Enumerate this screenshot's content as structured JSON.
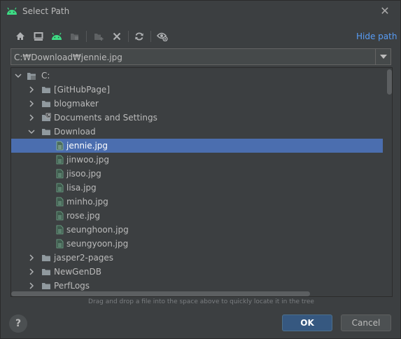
{
  "window": {
    "title": "Select Path"
  },
  "toolbar": {
    "buttons": [
      "home-icon",
      "desktop-icon",
      "android-project-icon",
      "module-icon",
      "new-folder-icon",
      "delete-icon",
      "refresh-icon",
      "show-hidden-icon"
    ],
    "hide_path_label": "Hide path"
  },
  "path": {
    "value": "C:₩Download₩jennie.jpg"
  },
  "tree": {
    "root": "C:",
    "folders_top": [
      "[GitHubPage]",
      "blogmaker",
      "Documents and Settings",
      "Download"
    ],
    "download_files": [
      "jennie.jpg",
      "jinwoo.jpg",
      "jisoo.jpg",
      "lisa.jpg",
      "minho.jpg",
      "rose.jpg",
      "seunghoon.jpg",
      "seungyoon.jpg"
    ],
    "selected": "jennie.jpg",
    "folders_bottom": [
      "jasper2-pages",
      "NewGenDB",
      "PerfLogs"
    ]
  },
  "hint": "Drag and drop a file into the space above to quickly locate it in the tree",
  "buttons": {
    "help": "?",
    "ok": "OK",
    "cancel": "Cancel"
  },
  "colors": {
    "accent": "#589df6",
    "selection": "#4b6eaf",
    "android": "#3ddc84",
    "file_icon": "#5f9f7f"
  }
}
